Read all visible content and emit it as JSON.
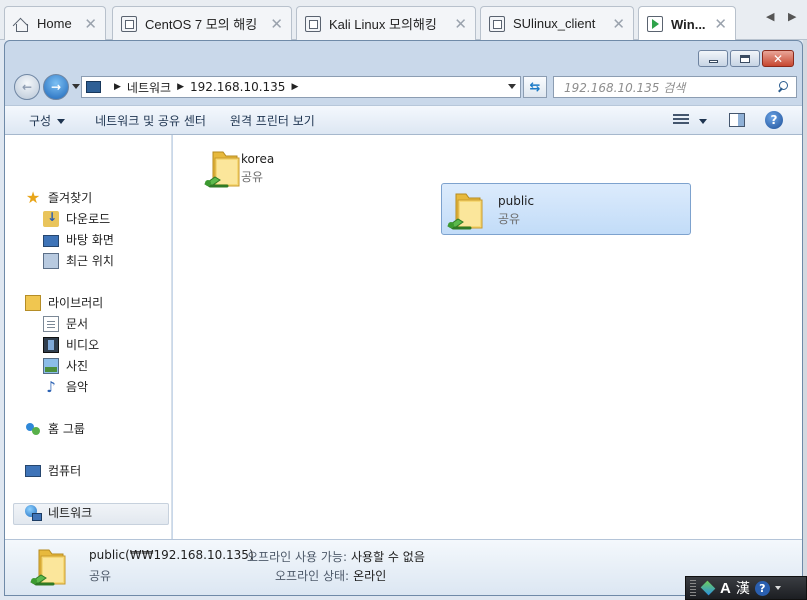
{
  "tabs": [
    {
      "label": "Home",
      "icon": "home-icon"
    },
    {
      "label": "CentOS 7 모의 해킹",
      "icon": "vm-tab-icon"
    },
    {
      "label": "Kali Linux 모의해킹",
      "icon": "vm-tab-icon"
    },
    {
      "label": "SUlinux_client",
      "icon": "vm-tab-icon"
    },
    {
      "label": "Win...",
      "icon": "vm-running-icon",
      "active": true
    }
  ],
  "address": {
    "root": "네트워크",
    "host": "192.168.10.135"
  },
  "search": {
    "placeholder": "192.168.10.135 검색"
  },
  "commands": {
    "organize": "구성",
    "network_center": "네트워크 및 공유 센터",
    "remote_printers": "원격 프린터 보기"
  },
  "navpane": {
    "favorites": "즐겨찾기",
    "downloads": "다운로드",
    "desktop": "바탕 화면",
    "recent": "최근 위치",
    "libraries": "라이브러리",
    "documents": "문서",
    "videos": "비디오",
    "pictures": "사진",
    "music": "음악",
    "homegroup": "홈 그룹",
    "computer": "컴퓨터",
    "network": "네트워크"
  },
  "shares": [
    {
      "name": "korea",
      "type": "공유",
      "selected": false
    },
    {
      "name": "public",
      "type": "공유",
      "selected": true
    }
  ],
  "details": {
    "name": "public(₩₩192.168.10.135)",
    "type": "공유",
    "offline_avail_label": "오프라인 사용 가능:",
    "offline_avail_value": "사용할 수 없음",
    "offline_status_label": "오프라인 상태:",
    "offline_status_value": "온라인"
  },
  "langbar": {
    "mode": "A",
    "hanja": "漢"
  },
  "colors": {
    "selection": "#c2dcf8",
    "folder": "#f2c94c",
    "accent": "#1e66b8"
  }
}
